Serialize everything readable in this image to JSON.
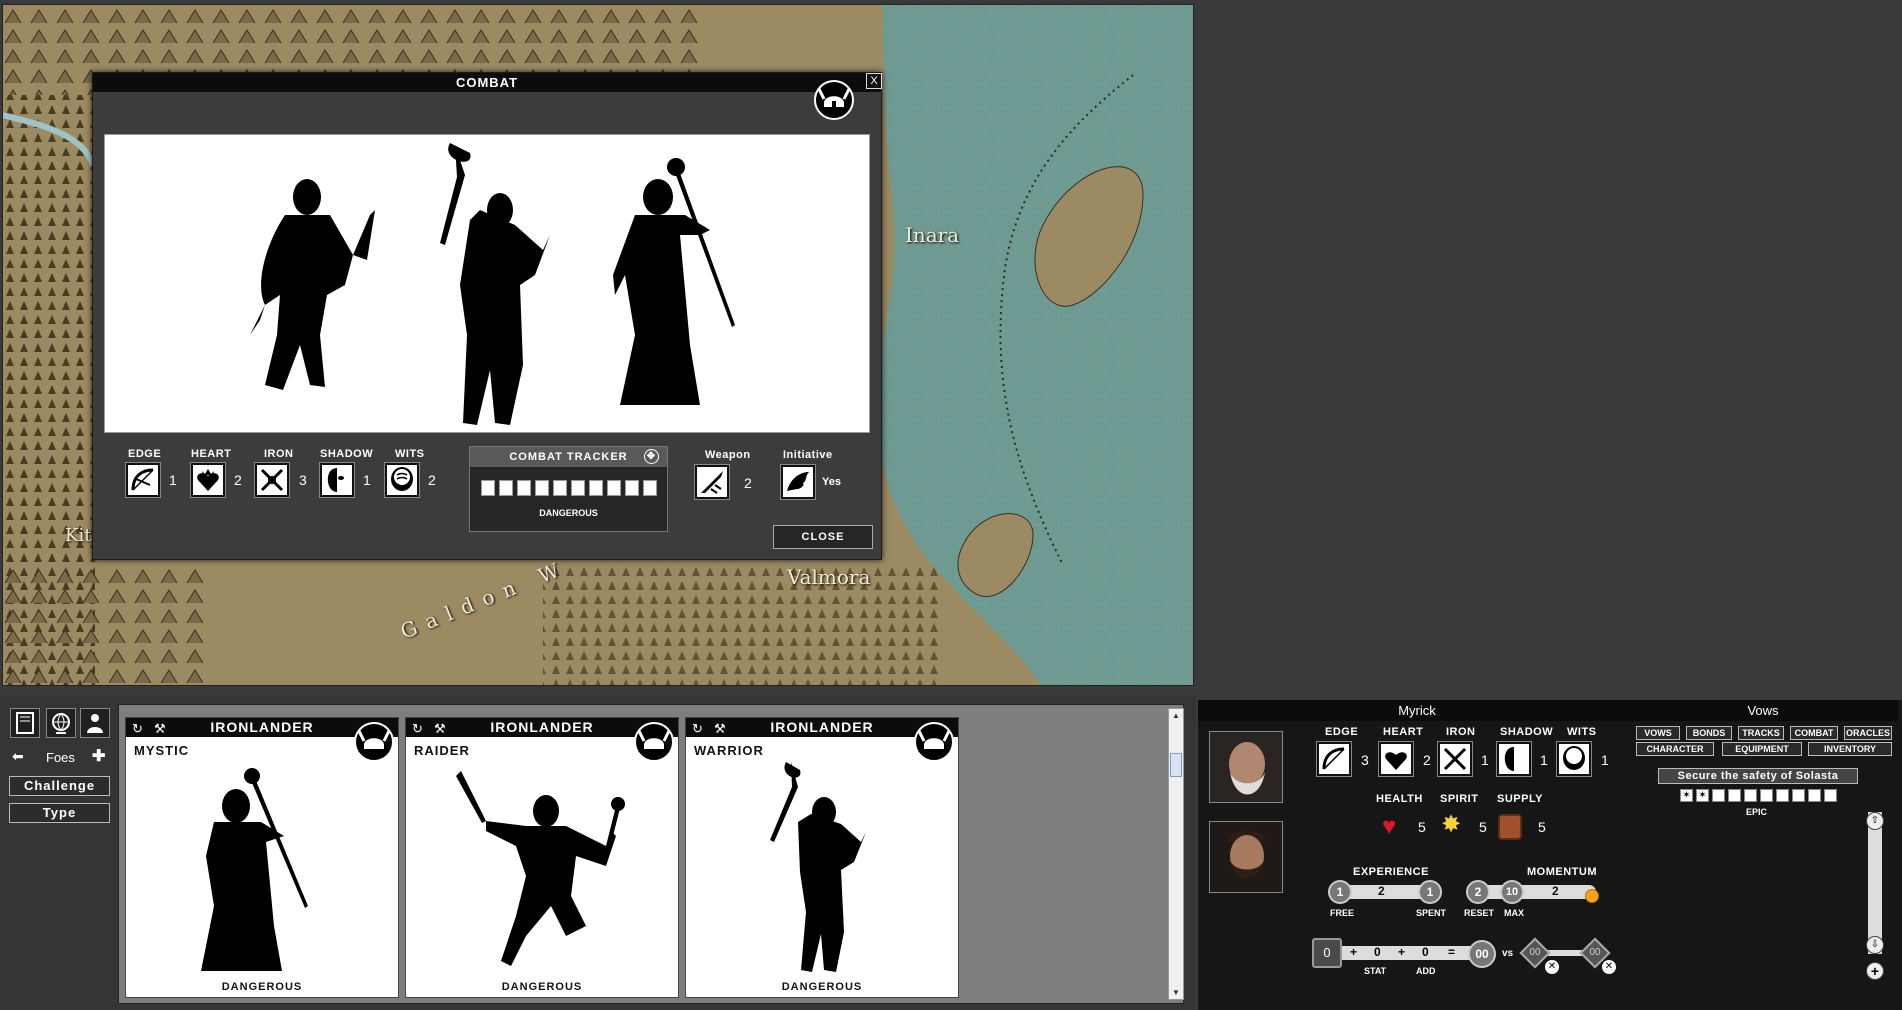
{
  "map": {
    "labels": [
      "Inara",
      "Valmora",
      "Galdon W",
      "Kit"
    ]
  },
  "combat": {
    "title": "COMBAT",
    "close_x": "X",
    "stats": [
      {
        "label": "EDGE",
        "value": "1",
        "icon": "bow-icon"
      },
      {
        "label": "HEART",
        "value": "2",
        "icon": "heart-crown-icon"
      },
      {
        "label": "IRON",
        "value": "3",
        "icon": "crossed-swords-icon"
      },
      {
        "label": "SHADOW",
        "value": "1",
        "icon": "mask-icon"
      },
      {
        "label": "WITS",
        "value": "2",
        "icon": "brain-icon"
      }
    ],
    "tracker": {
      "title": "COMBAT TRACKER",
      "boxes": 10,
      "rank": "DANGEROUS"
    },
    "weapon": {
      "label": "Weapon",
      "value": "2"
    },
    "initiative": {
      "label": "Initiative",
      "value": "Yes"
    },
    "close_label": "CLOSE"
  },
  "foes_panel": {
    "foes_label": "Foes",
    "challenge_label": "Challenge",
    "type_label": "Type"
  },
  "cards": [
    {
      "title": "IRONLANDER",
      "role": "MYSTIC",
      "rank": "DANGEROUS"
    },
    {
      "title": "IRONLANDER",
      "role": "RAIDER",
      "rank": "DANGEROUS"
    },
    {
      "title": "IRONLANDER",
      "role": "WARRIOR",
      "rank": "DANGEROUS"
    }
  ],
  "character": {
    "name": "Myrick",
    "stats": [
      {
        "label": "EDGE",
        "value": "3"
      },
      {
        "label": "HEART",
        "value": "2"
      },
      {
        "label": "IRON",
        "value": "1"
      },
      {
        "label": "SHADOW",
        "value": "1"
      },
      {
        "label": "WITS",
        "value": "1"
      }
    ],
    "resources": [
      {
        "label": "HEALTH",
        "value": "5"
      },
      {
        "label": "SPIRIT",
        "value": "5"
      },
      {
        "label": "SUPPLY",
        "value": "5"
      }
    ],
    "experience": {
      "label": "EXPERIENCE",
      "free": "1",
      "total": "2",
      "spent": "1",
      "free_label": "FREE",
      "spent_label": "SPENT"
    },
    "momentum": {
      "label": "MOMENTUM",
      "reset": "2",
      "max": "10",
      "value": "2",
      "reset_label": "RESET",
      "max_label": "MAX"
    },
    "roll": {
      "stat": "0",
      "plus1": "+",
      "a": "0",
      "plus2": "+",
      "b": "0",
      "eq": "=",
      "total": "00",
      "vs": "vs",
      "c1": "00",
      "c2": "00",
      "stat_label": "STAT",
      "add_label": "ADD"
    }
  },
  "vows": {
    "title": "Vows",
    "tabs": [
      "VOWS",
      "BONDS",
      "TRACKS",
      "COMBAT",
      "ORACLES",
      "CHARACTER",
      "EQUIPMENT",
      "INVENTORY"
    ],
    "vow_name": "Secure the safety of Solasta",
    "rank": "EPIC",
    "progress_filled": 2,
    "progress_boxes": 10
  }
}
